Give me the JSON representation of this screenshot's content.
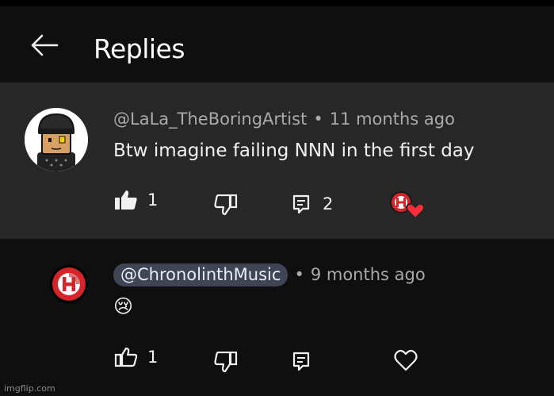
{
  "header": {
    "title": "Replies"
  },
  "comments": [
    {
      "author": "@LaLa_TheBoringArtist",
      "separator": "•",
      "time": "11 months ago",
      "text": "Btw imagine failing NNN in the first day",
      "likes": "1",
      "replies": "2",
      "liked": true,
      "hearted_by_creator": true
    },
    {
      "author": "@ChronolinthMusic",
      "separator": "•",
      "time": "9 months ago",
      "text": "😢",
      "likes": "1",
      "author_is_creator": true
    }
  ],
  "watermark": "imgflip.com",
  "colors": {
    "creator_chip": "#3e4555",
    "creator_red": "#d6242b",
    "heart": "#ff2d3a"
  }
}
